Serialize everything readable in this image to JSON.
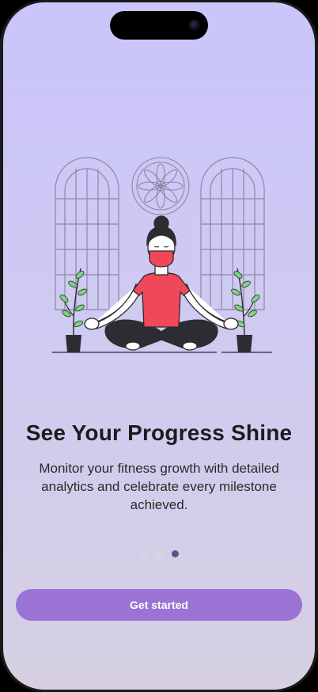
{
  "onboarding": {
    "title": "See Your Progress Shine",
    "description": "Monitor your fitness growth with detailed analytics and celebrate every milestone achieved.",
    "pagination": {
      "total": 3,
      "active_index": 2
    },
    "cta_label": "Get started"
  },
  "colors": {
    "background_top": "#cac5fb",
    "background_bottom": "#d6d0e2",
    "accent": "#9b73d4",
    "dot_active": "#5e4f8f",
    "dot_inactive": "#d9d4e4"
  }
}
